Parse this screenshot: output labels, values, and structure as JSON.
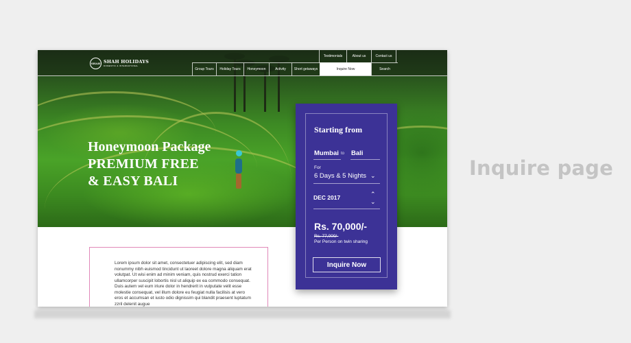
{
  "page_label": "Inquire page",
  "brand": {
    "seal_text": "SHAH",
    "name": "SHAH HOLIDAYS",
    "subtitle": "DOMESTIC & INTERNATIONAL"
  },
  "nav": {
    "top": [
      "Testimonials",
      "About us",
      "Contact us"
    ],
    "main": [
      "Group Tours",
      "Holiday Tours",
      "Honeymoon",
      "Activity",
      "Short getaways",
      "Inquire Now",
      "Search"
    ],
    "active": "Inquire Now"
  },
  "hero": {
    "line1": "Honeymoon Package",
    "line2": "PREMIUM FREE",
    "line3": "& EASY BALI"
  },
  "booking": {
    "title": "Starting from",
    "from": "Mumbai",
    "to_word": "to",
    "destination": "Bali",
    "for_label": "For",
    "duration": "6 Days & 5 Nights",
    "month": "DEC 2017",
    "price": "Rs. 70,000/-",
    "old_price": "Rs. 77,000/-",
    "price_note": "Per Person on twin sharing",
    "cta": "Inquire Now"
  },
  "body_text": "Lorem ipsum dolor sit amet, consectetuer adipiscing elit, sed diam nonummy nibh euismod tincidunt ut laoreet dolore magna aliquam erat volutpat. Ut wisi enim ad minim veniam, quis nostrud exerci tation ullamcorper suscipit lobortis nisl ut aliquip ex ea commodo consequat. Duis autem vel eum iriure dolor in hendrerit in vulputate velit esse molestie consequat, vel illum dolore eu feugiat nulla facilisis at vero eros et accumsan et iusto odio dignissim qui blandit praesent luptatum zzril delenit augue",
  "colors": {
    "booking_bg": "#3c3296",
    "text_box_border": "#e087b8",
    "page_label": "#c4c4c4"
  }
}
